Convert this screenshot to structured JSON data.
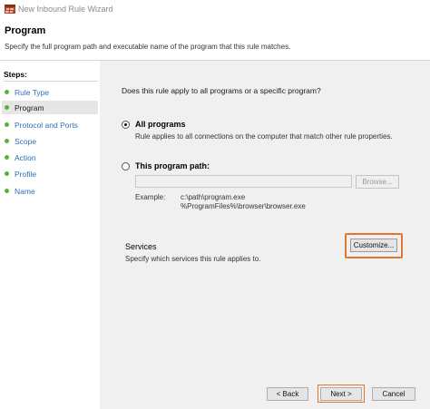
{
  "window": {
    "title": "New Inbound Rule Wizard",
    "icon": "firewall-wizard-icon"
  },
  "header": {
    "title": "Program",
    "description": "Specify the full program path and executable name of the program that this rule matches."
  },
  "steps": {
    "title": "Steps:",
    "items": [
      {
        "label": "Rule Type",
        "active": false
      },
      {
        "label": "Program",
        "active": true
      },
      {
        "label": "Protocol and Ports",
        "active": false
      },
      {
        "label": "Scope",
        "active": false
      },
      {
        "label": "Action",
        "active": false
      },
      {
        "label": "Profile",
        "active": false
      },
      {
        "label": "Name",
        "active": false
      }
    ]
  },
  "main": {
    "question": "Does this rule apply to all programs or a specific program?",
    "all_programs": {
      "label": "All programs",
      "description": "Rule applies to all connections on the computer that match other rule properties.",
      "checked": true
    },
    "program_path": {
      "label": "This program path:",
      "value": "",
      "checked": false,
      "browse_label": "Browse..."
    },
    "example": {
      "label": "Example:",
      "lines": [
        "c:\\path\\program.exe",
        "%ProgramFiles%\\browser\\browser.exe"
      ]
    },
    "services": {
      "title": "Services",
      "description": "Specify which services this rule applies to.",
      "button_label": "Customize..."
    }
  },
  "footer": {
    "back_label": "< Back",
    "next_label": "Next >",
    "cancel_label": "Cancel"
  },
  "colors": {
    "accent_highlight": "#e2762c",
    "step_bullet": "#55b33a",
    "step_link": "#2f6fb5"
  }
}
